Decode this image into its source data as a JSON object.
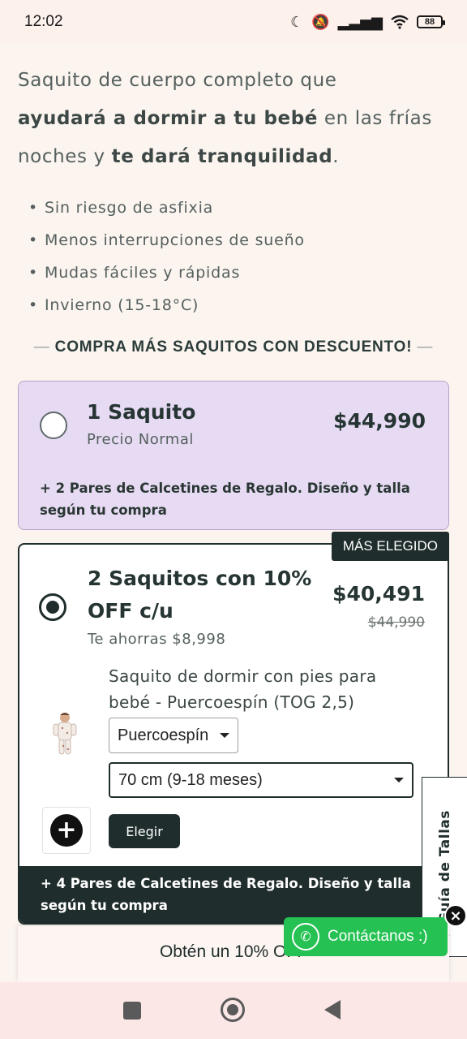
{
  "status_bar": {
    "time": "12:02",
    "battery": "88"
  },
  "intro": {
    "line1": "Saquito de cuerpo completo que",
    "bold1": "ayudará a dormir a tu bebé",
    "mid": " en las frías noches y ",
    "bold2": "te dará tranquilidad",
    "end": "."
  },
  "bullets": [
    "Sin riesgo de asfixia",
    "Menos interrupciones de sueño",
    "Mudas fáciles y rápidas",
    "Invierno (15-18°C)"
  ],
  "section_title": "COMPRA MÁS SAQUITOS CON DESCUENTO!",
  "offer1": {
    "title": "1 Saquito",
    "subtitle": "Precio Normal",
    "price": "$44,990",
    "gift": "+ 2 Pares de Calcetines de Regalo. Diseño y talla según tu compra",
    "selected": false
  },
  "offer2": {
    "badge": "MÁS ELEGIDO",
    "title_line1": "2 Saquitos con 10%",
    "title_line2": "OFF c/u",
    "savings": "Te ahorras $8,998",
    "price": "$40,491",
    "price_old": "$44,990",
    "selected": true,
    "product_name": "Saquito de dormir con pies para bebé - Puercoespín (TOG 2,5)",
    "design_select": "Puercoespín",
    "size_select": "70 cm (9-18 meses)",
    "choose_button": "Elegir",
    "gift": "+ 4 Pares de Calcetines de Regalo. Diseño y talla según tu compra"
  },
  "size_guide_tab": "Guía de Tallas",
  "promo_bar": "Obtén un 10% OFF",
  "whatsapp": {
    "label": "Contáctanos :)",
    "icon": "whatsapp-icon"
  }
}
